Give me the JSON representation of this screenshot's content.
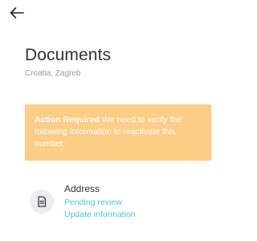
{
  "header": {
    "back_icon": "arrow-left-icon"
  },
  "page": {
    "title": "Documents",
    "subtitle": "Croatia, Zagreb"
  },
  "notice": {
    "label": "Action Required",
    "message": " We need to verify the following information to reactivate this number:",
    "background_color": "#fbcd87"
  },
  "documents": [
    {
      "icon": "document-icon",
      "label": "Address",
      "status": "Pending review",
      "action": "Update information"
    }
  ],
  "colors": {
    "accent": "#4fc2ce",
    "text": "#333333",
    "muted": "#9a9a9a"
  }
}
